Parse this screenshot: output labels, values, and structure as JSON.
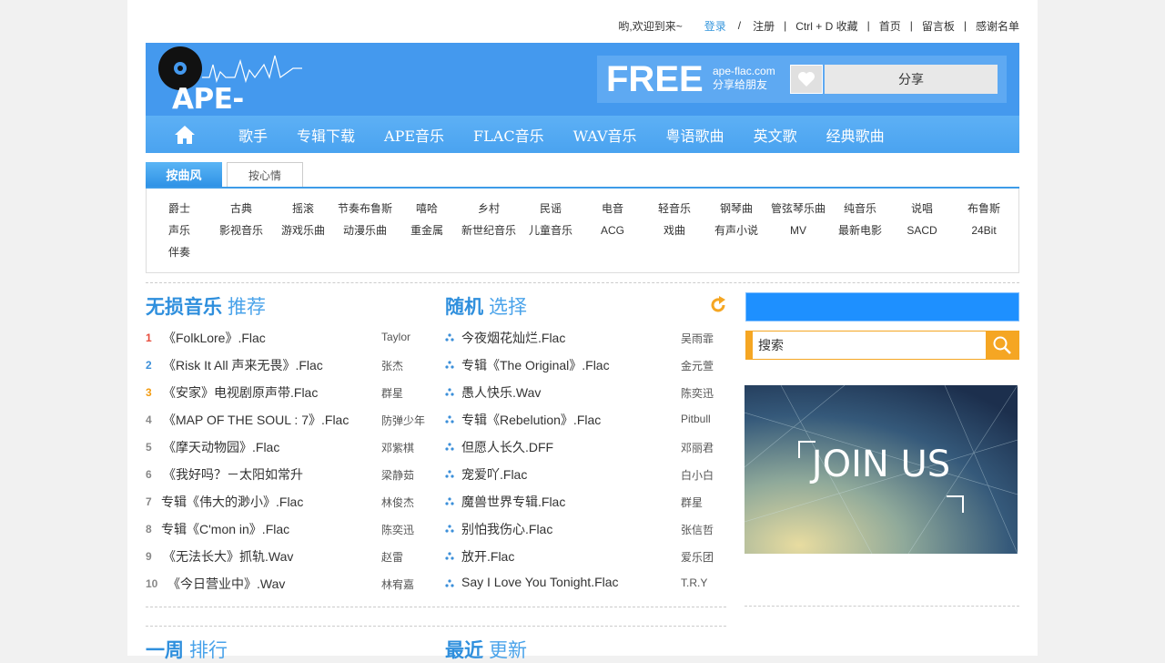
{
  "topbar": {
    "welcome": "哟,欢迎到来~",
    "login": "登录",
    "slash": "/",
    "register": "注册",
    "bookmark": "Ctrl + D 收藏",
    "home": "首页",
    "guestbook": "留言板",
    "thanks": "感谢名单",
    "sep": "|"
  },
  "header": {
    "logo_text": "APE-FLAC",
    "free": "FREE",
    "free_domain": "ape-flac.com",
    "free_tagline": "分享给朋友",
    "share_label": "分享"
  },
  "nav": {
    "items": [
      "歌手",
      "专辑下载",
      "APE音乐",
      "FLAC音乐",
      "WAV音乐",
      "粤语歌曲",
      "英文歌",
      "经典歌曲"
    ]
  },
  "tabs": {
    "active": "按曲风",
    "inactive": "按心情"
  },
  "genres": [
    "爵士",
    "古典",
    "摇滚",
    "节奏布鲁斯",
    "嘻哈",
    "乡村",
    "民谣",
    "电音",
    "轻音乐",
    "钢琴曲",
    "管弦琴乐曲",
    "纯音乐",
    "说唱",
    "布鲁斯",
    "声乐",
    "影视音乐",
    "游戏乐曲",
    "动漫乐曲",
    "重金属",
    "新世纪音乐",
    "儿童音乐",
    "ACG",
    "戏曲",
    "有声小说",
    "MV",
    "最新电影",
    "SACD",
    "24Bit",
    "伴奏"
  ],
  "recommend": {
    "title_bold": "无损音乐",
    "title_light": "推荐",
    "rows": [
      {
        "num": "1",
        "title": "《FolkLore》.Flac",
        "artist": "Taylor"
      },
      {
        "num": "2",
        "title": "《Risk It All 声来无畏》.Flac",
        "artist": "张杰"
      },
      {
        "num": "3",
        "title": "《安家》电视剧原声带.Flac",
        "artist": "群星"
      },
      {
        "num": "4",
        "title": "《MAP OF THE SOUL : 7》.Flac",
        "artist": "防弹少年"
      },
      {
        "num": "5",
        "title": "《摩天动物园》.Flac",
        "artist": "邓紫棋"
      },
      {
        "num": "6",
        "title": "《我好吗？－太阳如常升",
        "artist": "梁静茹"
      },
      {
        "num": "7",
        "title": "专辑《伟大的渺小》.Flac",
        "artist": "林俊杰"
      },
      {
        "num": "8",
        "title": "专辑《C'mon in》.Flac",
        "artist": "陈奕迅"
      },
      {
        "num": "9",
        "title": "《无法长大》抓轨.Wav",
        "artist": "赵雷"
      },
      {
        "num": "10",
        "title": "《今日营业中》.Wav",
        "artist": "林宥嘉"
      }
    ]
  },
  "random": {
    "title_bold": "随机",
    "title_light": "选择",
    "rows": [
      {
        "title": "今夜烟花灿烂.Flac",
        "artist": "吴雨霏"
      },
      {
        "title": "专辑《The Original》.Flac",
        "artist": "金元萱"
      },
      {
        "title": "愚人快乐.Wav",
        "artist": "陈奕迅"
      },
      {
        "title": "专辑《Rebelution》.Flac",
        "artist": "Pitbull"
      },
      {
        "title": "但愿人长久.DFF",
        "artist": "邓丽君"
      },
      {
        "title": "宠爱吖.Flac",
        "artist": "白小白"
      },
      {
        "title": "魔兽世界专辑.Flac",
        "artist": "群星"
      },
      {
        "title": "别怕我伤心.Flac",
        "artist": "张信哲"
      },
      {
        "title": "放开.Flac",
        "artist": "爱乐团"
      },
      {
        "title": "Say I Love You Tonight.Flac",
        "artist": "T.R.Y"
      }
    ]
  },
  "search": {
    "value": "搜索"
  },
  "banner": {
    "text": "JOIN US"
  },
  "weekly": {
    "title_bold": "一周",
    "title_light": "排行"
  },
  "latest": {
    "title_bold": "最近",
    "title_light": "更新"
  }
}
